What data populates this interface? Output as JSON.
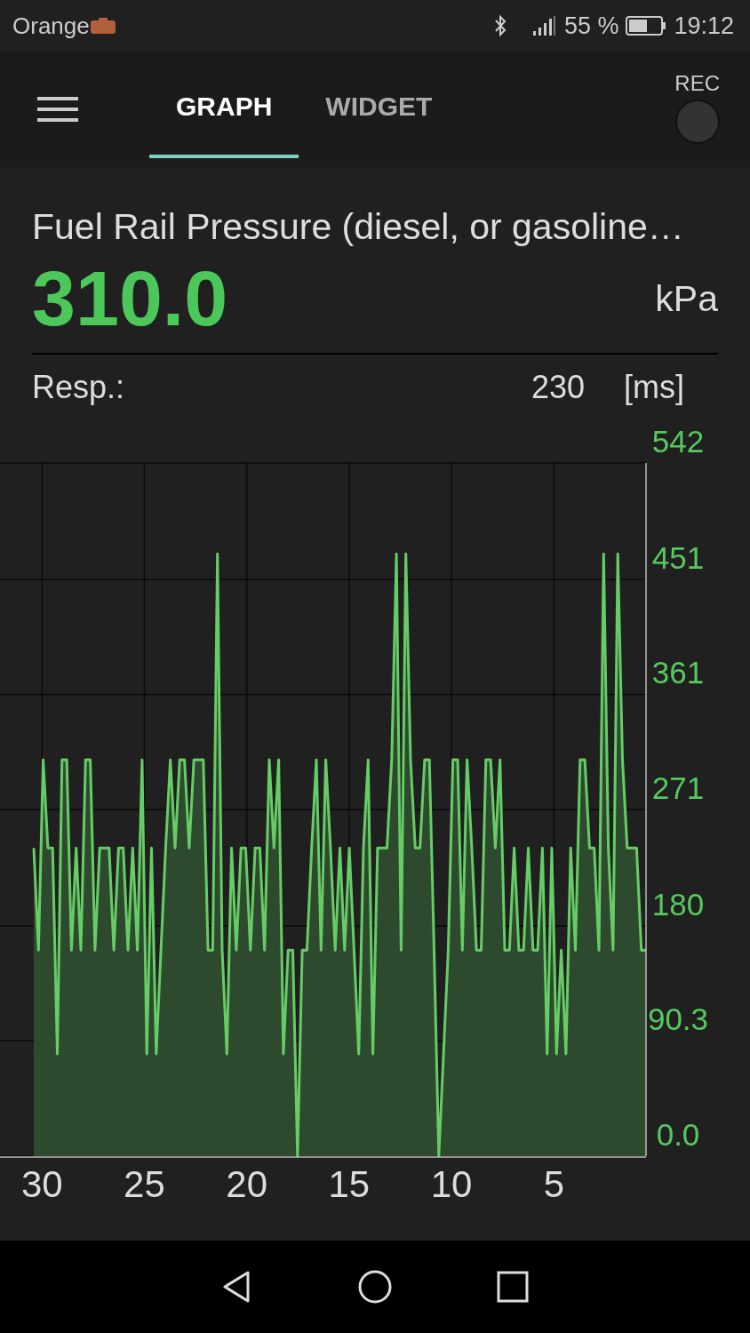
{
  "status_bar": {
    "carrier": "Orange",
    "battery": "55 %",
    "time": "19:12"
  },
  "tabs": [
    {
      "label": "GRAPH",
      "selected": true
    },
    {
      "label": "WIDGET",
      "selected": false
    }
  ],
  "rec": {
    "label": "REC",
    "on": false
  },
  "sensor": {
    "title": "Fuel Rail Pressure (diesel, or gasoline…",
    "value": "310.0",
    "unit": "kPa",
    "resp_label": "Resp.:",
    "resp_value": "230",
    "resp_unit": "[ms]"
  },
  "chart_data": {
    "type": "area",
    "xlim": [
      32.05,
      0.5
    ],
    "ylim": [
      0,
      542
    ],
    "grid": true,
    "x": [
      30.4,
      30.17,
      29.94,
      29.71,
      29.48,
      29.25,
      29.02,
      28.79,
      28.56,
      28.33,
      28.1,
      27.87,
      27.64,
      27.41,
      27.18,
      26.95,
      26.72,
      26.49,
      26.26,
      26.03,
      25.8,
      25.57,
      25.34,
      25.11,
      24.88,
      24.65,
      24.42,
      24.19,
      23.96,
      23.73,
      23.5,
      23.27,
      23.04,
      22.81,
      22.58,
      22.35,
      22.12,
      21.89,
      21.66,
      21.43,
      21.2,
      20.97,
      20.74,
      20.51,
      20.28,
      20.05,
      19.82,
      19.59,
      19.36,
      19.13,
      18.9,
      18.67,
      18.44,
      18.21,
      17.98,
      17.75,
      17.52,
      17.29,
      17.06,
      16.83,
      16.6,
      16.37,
      16.14,
      15.91,
      15.68,
      15.45,
      15.22,
      14.99,
      14.76,
      14.53,
      14.3,
      14.07,
      13.84,
      13.61,
      13.38,
      13.15,
      12.92,
      12.69,
      12.46,
      12.23,
      12.0,
      11.77,
      11.54,
      11.31,
      11.08,
      10.85,
      10.62,
      10.39,
      10.16,
      9.93,
      9.7,
      9.47,
      9.24,
      9.01,
      8.78,
      8.55,
      8.32,
      8.09,
      7.86,
      7.63,
      7.4,
      7.17,
      6.94,
      6.71,
      6.48,
      6.25,
      6.02,
      5.79,
      5.56,
      5.33,
      5.1,
      4.87,
      4.64,
      4.41,
      4.18,
      3.95,
      3.72,
      3.49,
      3.26,
      3.03,
      2.8,
      2.57,
      2.34,
      2.11,
      1.88,
      1.65,
      1.42,
      1.19,
      0.96,
      0.73,
      0.5
    ],
    "xticks": [
      30,
      25,
      20,
      15,
      10,
      5
    ],
    "yticks": [
      {
        "value": 0,
        "label": "0.0"
      },
      90.3,
      180,
      271,
      361,
      451,
      542
    ],
    "series": [
      {
        "color": "#66cc66",
        "values": [
          241,
          161,
          310,
          241,
          241,
          80,
          310,
          310,
          161,
          241,
          161,
          310,
          310,
          161,
          241,
          241,
          241,
          161,
          241,
          241,
          161,
          241,
          161,
          310,
          80,
          241,
          80,
          161,
          241,
          310,
          241,
          310,
          310,
          241,
          310,
          310,
          310,
          161,
          161,
          471,
          161,
          80,
          241,
          161,
          241,
          241,
          161,
          241,
          241,
          161,
          310,
          241,
          310,
          80,
          161,
          161,
          0,
          161,
          161,
          241,
          310,
          161,
          310,
          241,
          161,
          241,
          161,
          241,
          161,
          80,
          241,
          310,
          80,
          241,
          241,
          241,
          310,
          471,
          161,
          471,
          310,
          241,
          241,
          310,
          310,
          161,
          0,
          80,
          161,
          310,
          310,
          161,
          310,
          241,
          161,
          161,
          310,
          310,
          241,
          310,
          161,
          161,
          241,
          161,
          161,
          241,
          161,
          161,
          241,
          80,
          241,
          80,
          161,
          80,
          241,
          161,
          310,
          310,
          241,
          241,
          161,
          471,
          241,
          161,
          471,
          310,
          241,
          241,
          241,
          161,
          161
        ]
      }
    ]
  }
}
